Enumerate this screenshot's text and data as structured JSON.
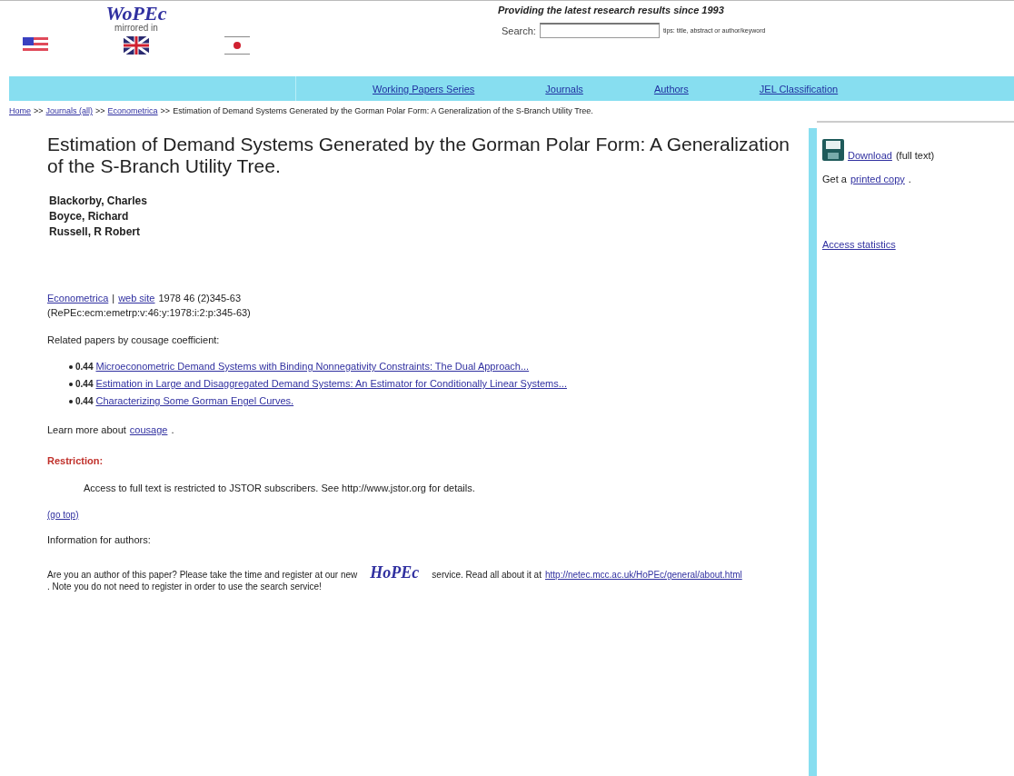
{
  "header": {
    "logo": "WoPEc",
    "mirrored_label": "mirrored in",
    "tagline": "Providing the latest research results since 1993",
    "search": {
      "label": "Search:",
      "hint": "tips: title, abstract or author/keyword"
    }
  },
  "nav": [
    "Working Papers Series",
    "Journals",
    "Authors",
    "JEL Classification"
  ],
  "breadcrumb": [
    {
      "text": "Home",
      "link": true
    },
    {
      "text": ">>",
      "link": false
    },
    {
      "text": "Journals (all)",
      "link": true
    },
    {
      "text": ">>",
      "link": false
    },
    {
      "text": "Econometrica",
      "link": true
    },
    {
      "text": ">>",
      "link": false
    },
    {
      "text": "Estimation of Demand Systems Generated by the Gorman Polar Form: A Generalization of the S-Branch Utility Tree.",
      "link": false
    }
  ],
  "title": "Estimation of Demand Systems Generated by the Gorman Polar Form: A Generalization of the S-Branch Utility Tree.",
  "authors": [
    "Blackorby, Charles",
    "Boyce, Richard",
    "Russell, R Robert"
  ],
  "citation": {
    "journal": "Econometrica",
    "separator": "|",
    "site": "web site",
    "details": "1978 46 (2)345-63",
    "handle": "(RePEc:ecm:emetrp:v:46:y:1978:i:2:p:345-63)"
  },
  "related_heading": "Related papers by cousage coefficient:",
  "related": [
    {
      "score": "0.44",
      "title": "Microeconometric Demand Systems with Binding Nonnegativity Constraints: The Dual Approach..."
    },
    {
      "score": "0.44",
      "title": "Estimation in Large and Disaggregated Demand Systems: An Estimator for Conditionally Linear Systems..."
    },
    {
      "score": "0.44",
      "title": "Characterizing Some Gorman Engel Curves."
    }
  ],
  "learn_more": {
    "text": "Learn more about",
    "link": "cousage",
    "end": "."
  },
  "restriction": {
    "heading": "Restriction:",
    "text": "Access to full text is restricted to JSTOR subscribers. See http://www.jstor.org for details."
  },
  "go_top": "(go top)",
  "info_heading": "Information for authors:",
  "author_note": {
    "before": "Are you an author of this paper? Please take the time and register at our new",
    "logo": "HoPEc",
    "middle": "service. Read all about it at",
    "link": "http://netec.mcc.ac.uk/HoPEc/general/about.html",
    "after": ". Note you do not need to register in order to use the search service!"
  },
  "sidebar": {
    "download": "Download",
    "download_note": "(full text)",
    "printed_before": "Get a",
    "printed_link": "printed copy",
    "printed_after": ".",
    "stats": "Access statistics"
  }
}
